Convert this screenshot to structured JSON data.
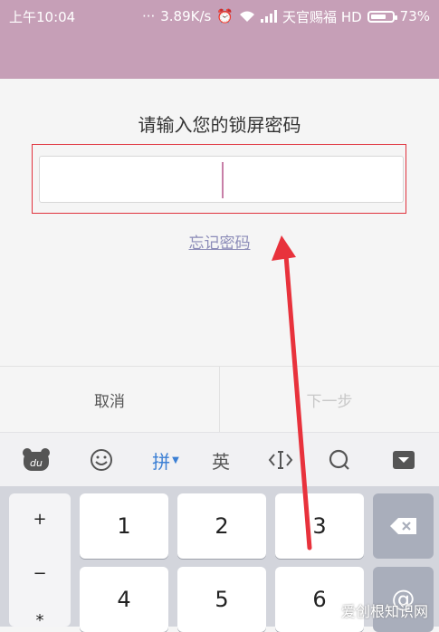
{
  "status_bar": {
    "time": "上午10:04",
    "speed": "3.89K/s",
    "carrier": "天官赐福 HD",
    "battery": "73%",
    "battery_level": 0.73
  },
  "dialog": {
    "title": "请输入您的锁屏密码",
    "password_value": "",
    "forgot_label": "忘记密码",
    "cancel_label": "取消",
    "next_label": "下一步"
  },
  "toolbar": {
    "pinyin_label": "拼",
    "english_label": "英"
  },
  "keyboard": {
    "symbols": [
      "+",
      "−",
      "*"
    ],
    "keys": [
      "1",
      "2",
      "3",
      "4",
      "5",
      "6"
    ]
  },
  "watermark": "爱创根知识网",
  "colors": {
    "status_bg": "#c69fb7",
    "accent_blue": "#3b7fd4",
    "highlight_red": "#e0323d"
  }
}
